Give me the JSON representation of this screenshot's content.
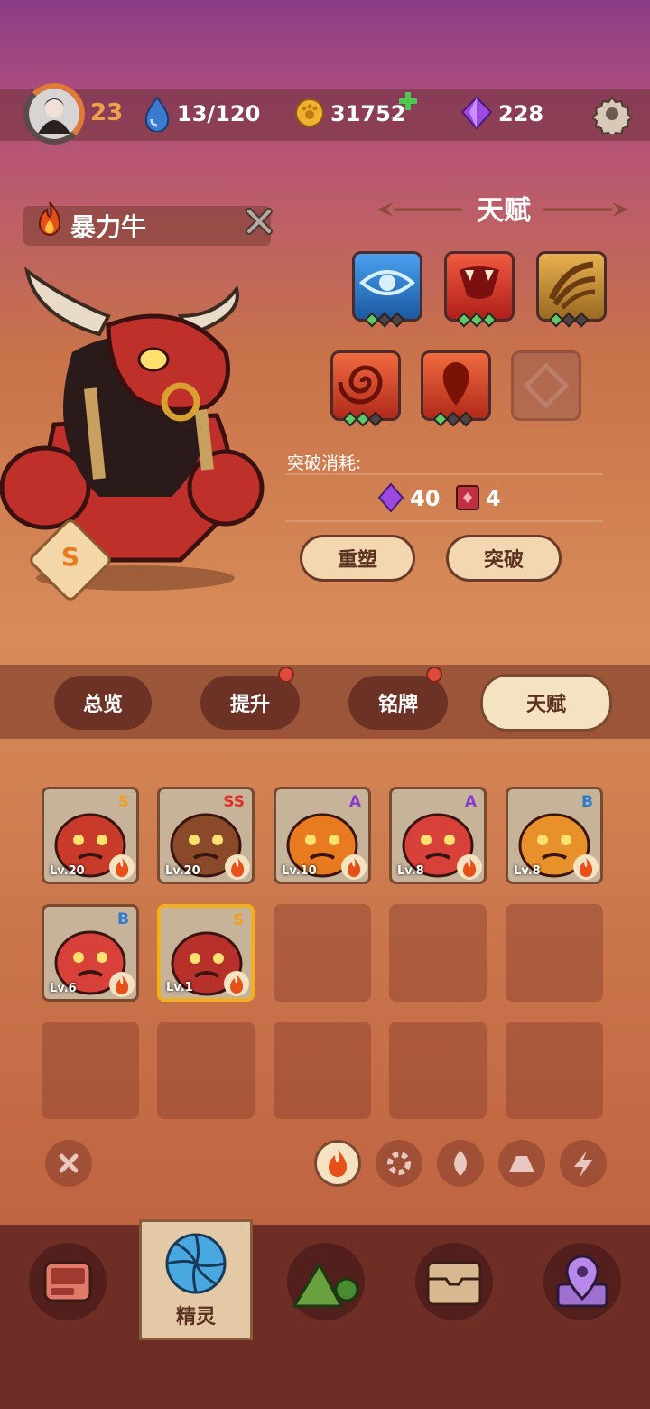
{
  "top_bar": {
    "player_level": "23",
    "stamina": "13/120",
    "coins": "31752",
    "gems": "228"
  },
  "pet": {
    "name": "暴力牛",
    "rank": "S"
  },
  "talent_panel": {
    "title": "天赋",
    "slots": [
      {
        "icon": "eye-icon",
        "color": "#2f7fd0",
        "gems": [
          true,
          false,
          false
        ]
      },
      {
        "icon": "fang-icon",
        "color": "#d03a2a",
        "gems": [
          true,
          true,
          true
        ]
      },
      {
        "icon": "claw-icon",
        "color": "#b88a2a",
        "gems": [
          true,
          false,
          false
        ]
      },
      {
        "icon": "swirl-icon",
        "color": "#c83a24",
        "gems": [
          true,
          true,
          false
        ]
      },
      {
        "icon": "drop-icon",
        "color": "#c83a24",
        "gems": [
          true,
          false,
          false
        ]
      }
    ],
    "breakthrough_cost_label": "突破消耗:",
    "cost_gems": "40",
    "cost_books": "4",
    "reshape_button": "重塑",
    "breakthrough_button": "突破"
  },
  "tabs": [
    {
      "label": "总览",
      "active": false,
      "badge": false
    },
    {
      "label": "提升",
      "active": false,
      "badge": true
    },
    {
      "label": "铭牌",
      "active": false,
      "badge": true
    },
    {
      "label": "天赋",
      "active": true,
      "badge": false
    }
  ],
  "pets_grid": [
    {
      "rank": "S",
      "rank_color": "#f0a020",
      "level": "Lv.20",
      "name_icon": "dragon-icon",
      "body": "#c83a2a"
    },
    {
      "rank": "SS",
      "rank_color": "#e0302a",
      "level": "Lv.20",
      "name_icon": "golem-icon",
      "body": "#8a4a2a"
    },
    {
      "rank": "A",
      "rank_color": "#8a3ad0",
      "level": "Lv.10",
      "name_icon": "flame-spirit-icon",
      "body": "#e87a20"
    },
    {
      "rank": "A",
      "rank_color": "#8a3ad0",
      "level": "Lv.8",
      "name_icon": "horn-blob-icon",
      "body": "#d8403a"
    },
    {
      "rank": "B",
      "rank_color": "#2a7ad0",
      "level": "Lv.8",
      "name_icon": "fox-icon",
      "body": "#e8902a"
    },
    {
      "rank": "B",
      "rank_color": "#2a7ad0",
      "level": "Lv.6",
      "name_icon": "horn-blob-icon",
      "body": "#d8403a"
    },
    {
      "rank": "S",
      "rank_color": "#f0a020",
      "level": "Lv.1",
      "name_icon": "bull-icon",
      "body": "#b8302a",
      "selected": true
    }
  ],
  "filters": [
    "clear-icon",
    "fire-icon",
    "wind-icon",
    "leaf-icon",
    "earth-icon",
    "thunder-icon"
  ],
  "bottom_nav": {
    "items": [
      "monitor-icon",
      "spirit-icon",
      "mountain-icon",
      "chest-icon",
      "map-pin-icon"
    ],
    "active_label": "精灵"
  }
}
